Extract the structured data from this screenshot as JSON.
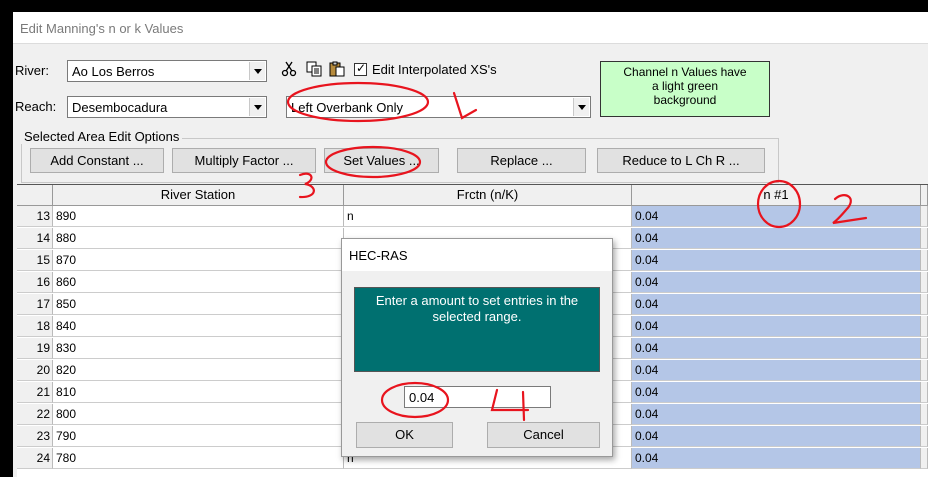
{
  "window": {
    "title": "Edit Manning's n or k Values"
  },
  "river": {
    "label": "River:",
    "value": "Ao Los Berros"
  },
  "reach": {
    "label": "Reach:",
    "value": "Desembocadura"
  },
  "toolbar": {
    "edit_interpolated_label": "Edit Interpolated XS's",
    "edit_interpolated_checked": true
  },
  "region_select": {
    "value": "Left Overbank Only"
  },
  "info_box": {
    "line1": "Channel n Values have",
    "line2": "a light green",
    "line3": "background",
    "color": "#c8ffc8"
  },
  "edit_options": {
    "title": "Selected Area Edit Options",
    "buttons": [
      "Add Constant ...",
      "Multiply Factor ...",
      "Set Values ...",
      "Replace ...",
      "Reduce to L Ch R ..."
    ]
  },
  "table": {
    "headers": [
      "River Station",
      "Frctn (n/K)",
      "n #1"
    ],
    "rows": [
      {
        "num": "13",
        "station": "890",
        "frctn": "n",
        "n1": "0.04"
      },
      {
        "num": "14",
        "station": "880",
        "frctn": "",
        "n1": "0.04"
      },
      {
        "num": "15",
        "station": "870",
        "frctn": "",
        "n1": "0.04"
      },
      {
        "num": "16",
        "station": "860",
        "frctn": "",
        "n1": "0.04"
      },
      {
        "num": "17",
        "station": "850",
        "frctn": "",
        "n1": "0.04"
      },
      {
        "num": "18",
        "station": "840",
        "frctn": "",
        "n1": "0.04"
      },
      {
        "num": "19",
        "station": "830",
        "frctn": "",
        "n1": "0.04"
      },
      {
        "num": "20",
        "station": "820",
        "frctn": "",
        "n1": "0.04"
      },
      {
        "num": "21",
        "station": "810",
        "frctn": "",
        "n1": "0.04"
      },
      {
        "num": "22",
        "station": "800",
        "frctn": "",
        "n1": "0.04"
      },
      {
        "num": "23",
        "station": "790",
        "frctn": "",
        "n1": "0.04"
      },
      {
        "num": "24",
        "station": "780",
        "frctn": "n",
        "n1": "0.04"
      }
    ],
    "selected_color": "#b4c6e7"
  },
  "dialog": {
    "title": "HEC-RAS",
    "message": "Enter a amount to set entries in the selected range.",
    "input_value": "0.04",
    "ok_label": "OK",
    "cancel_label": "Cancel"
  },
  "annotations": {
    "marks": [
      "1",
      "2",
      "3",
      "4"
    ],
    "color": "#e8141e"
  }
}
